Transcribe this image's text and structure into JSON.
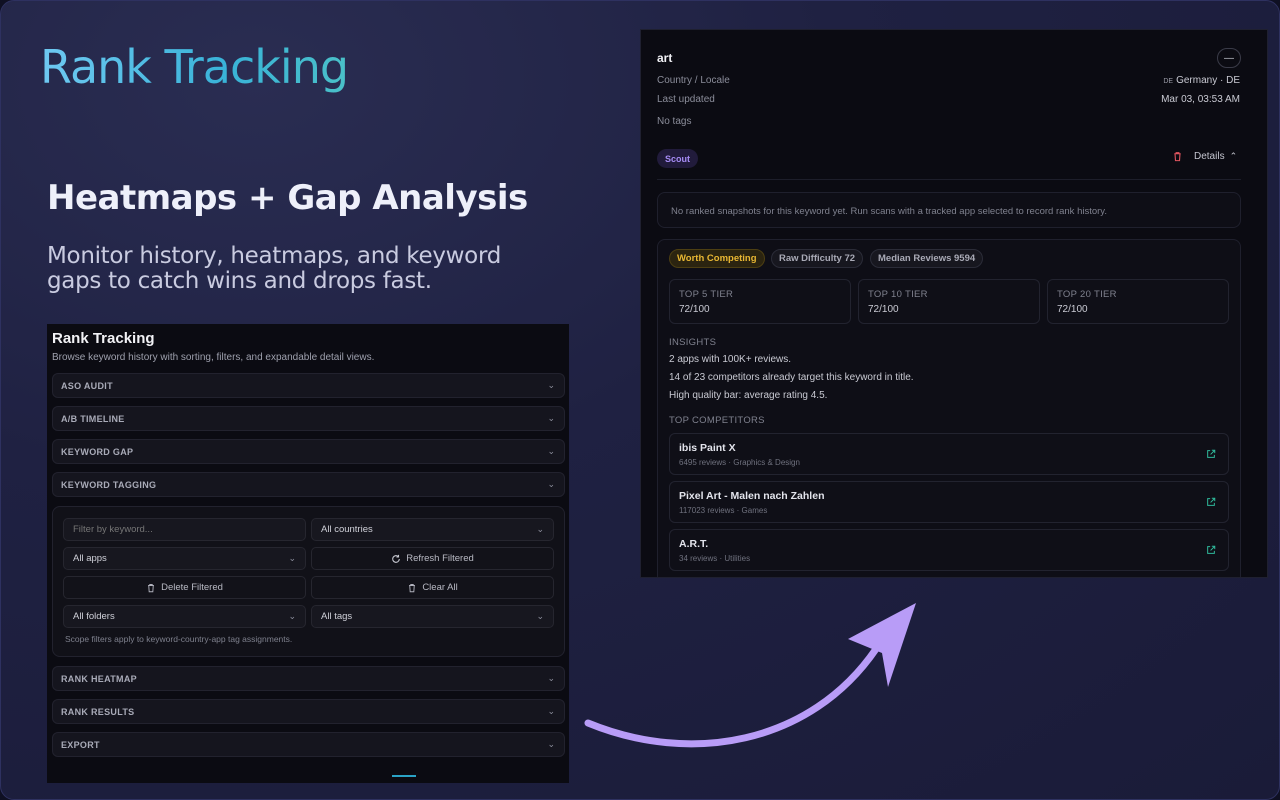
{
  "hero": {
    "brand": "Rank Tracking",
    "headline": "Heatmaps + Gap Analysis",
    "subline": "Monitor history, heatmaps, and keyword gaps to catch wins and drops fast."
  },
  "left_panel": {
    "title": "Rank Tracking",
    "description": "Browse keyword history with sorting, filters, and expandable detail views.",
    "sections_top": [
      "ASO AUDIT",
      "A/B TIMELINE",
      "KEYWORD GAP",
      "KEYWORD TAGGING"
    ],
    "filters": {
      "keyword_placeholder": "Filter by keyword...",
      "countries": "All countries",
      "apps": "All apps",
      "refresh": "Refresh Filtered",
      "delete": "Delete Filtered",
      "clear": "Clear All",
      "folders": "All folders",
      "tags": "All tags",
      "note": "Scope filters apply to keyword-country-app tag assignments."
    },
    "sections_bottom": [
      "RANK HEATMAP",
      "RANK RESULTS",
      "EXPORT"
    ]
  },
  "right_panel": {
    "title": "art",
    "collapse": "—",
    "country_label": "Country / Locale",
    "country_code": "DE",
    "country_value": "Germany · DE",
    "updated_label": "Last updated",
    "updated_value": "Mar 03, 03:53 AM",
    "tags": "No tags",
    "badge": "Scout",
    "details": "Details",
    "empty_msg": "No ranked snapshots for this keyword yet. Run scans with a tracked app selected to record rank history.",
    "pills": [
      "Worth Competing",
      "Raw Difficulty 72",
      "Median Reviews 9594"
    ],
    "tiers": [
      {
        "label": "TOP 5 TIER",
        "value": "72/100"
      },
      {
        "label": "TOP 10 TIER",
        "value": "72/100"
      },
      {
        "label": "TOP 20 TIER",
        "value": "72/100"
      }
    ],
    "insights_label": "INSIGHTS",
    "insights": [
      "2 apps with 100K+ reviews.",
      "14 of 23 competitors already target this keyword in title.",
      "High quality bar: average rating 4.5."
    ],
    "competitors_label": "TOP COMPETITORS",
    "competitors": [
      {
        "name": "ibis Paint X",
        "meta": "6495 reviews · Graphics & Design"
      },
      {
        "name": "Pixel Art  -  Malen nach Zahlen",
        "meta": "117023 reviews · Games"
      },
      {
        "name": "A.R.T.",
        "meta": "34 reviews · Utilities"
      }
    ]
  },
  "colors": {
    "accent_cyan": "#39b3d8",
    "scout_purple": "#a68cf4",
    "worth_yellow": "#e8b733",
    "arrow_violet": "#b89cf7"
  }
}
